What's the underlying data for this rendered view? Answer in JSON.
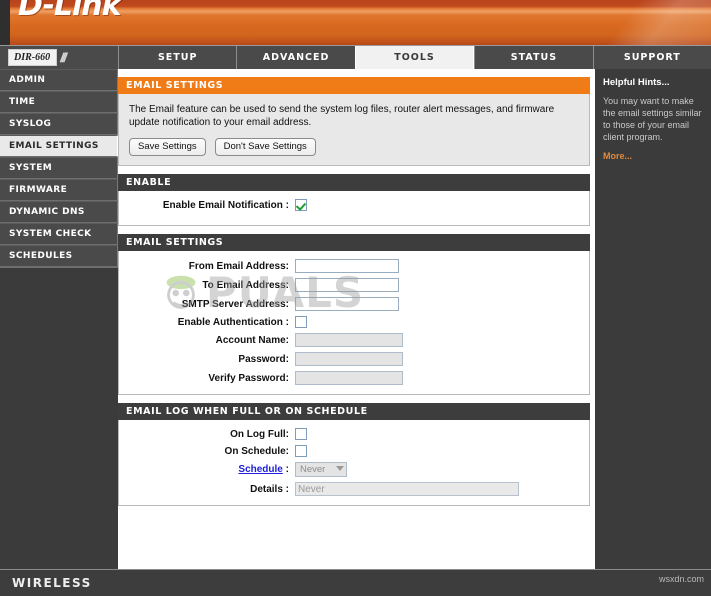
{
  "brand": {
    "logo_text": "D-Link",
    "accent_orange": "#f07c18",
    "panel_dark": "#3d3d3d"
  },
  "nav": {
    "model": "DIR-660",
    "tabs": [
      {
        "label": "SETUP",
        "active": false
      },
      {
        "label": "ADVANCED",
        "active": false
      },
      {
        "label": "TOOLS",
        "active": true
      },
      {
        "label": "STATUS",
        "active": false
      },
      {
        "label": "SUPPORT",
        "active": false
      }
    ]
  },
  "sidebar": {
    "items": [
      {
        "label": "ADMIN",
        "active": false
      },
      {
        "label": "TIME",
        "active": false
      },
      {
        "label": "SYSLOG",
        "active": false
      },
      {
        "label": "EMAIL SETTINGS",
        "active": true
      },
      {
        "label": "SYSTEM",
        "active": false
      },
      {
        "label": "FIRMWARE",
        "active": false
      },
      {
        "label": "DYNAMIC DNS",
        "active": false
      },
      {
        "label": "SYSTEM CHECK",
        "active": false
      },
      {
        "label": "SCHEDULES",
        "active": false
      }
    ]
  },
  "main": {
    "header_panel": {
      "title": "EMAIL SETTINGS",
      "description": "The Email feature can be used to send the system log files, router alert messages, and firmware update notification to your email address.",
      "save_label": "Save Settings",
      "dont_save_label": "Don't Save Settings"
    },
    "enable_panel": {
      "title": "ENABLE",
      "enable_notification_label": "Enable Email Notification :",
      "enable_notification_checked": true
    },
    "settings_panel": {
      "title": "EMAIL SETTINGS",
      "from_label": "From Email Address:",
      "from_value": "",
      "to_label": "To Email Address:",
      "to_value": "",
      "smtp_label": "SMTP Server Address:",
      "smtp_value": "",
      "auth_label": "Enable Authentication :",
      "auth_checked": false,
      "account_label": "Account Name:",
      "account_value": "",
      "password_label": "Password:",
      "password_value": "",
      "verify_label": "Verify Password:",
      "verify_value": ""
    },
    "log_panel": {
      "title": "EMAIL LOG WHEN FULL OR ON SCHEDULE",
      "on_log_full_label": "On Log Full:",
      "on_log_full_checked": false,
      "on_schedule_label": "On Schedule:",
      "on_schedule_checked": false,
      "schedule_link_label": "Schedule",
      "schedule_colon": ":",
      "schedule_value": "Never",
      "details_label": "Details :",
      "details_value": "Never"
    }
  },
  "hints": {
    "title": "Helpful Hints...",
    "body": "You may want to make the email settings similar to those of your email client program.",
    "more_label": "More..."
  },
  "footer": {
    "label": "WIRELESS",
    "watermark": "wsxdn.com"
  },
  "watermark": {
    "text": "PUALS"
  }
}
